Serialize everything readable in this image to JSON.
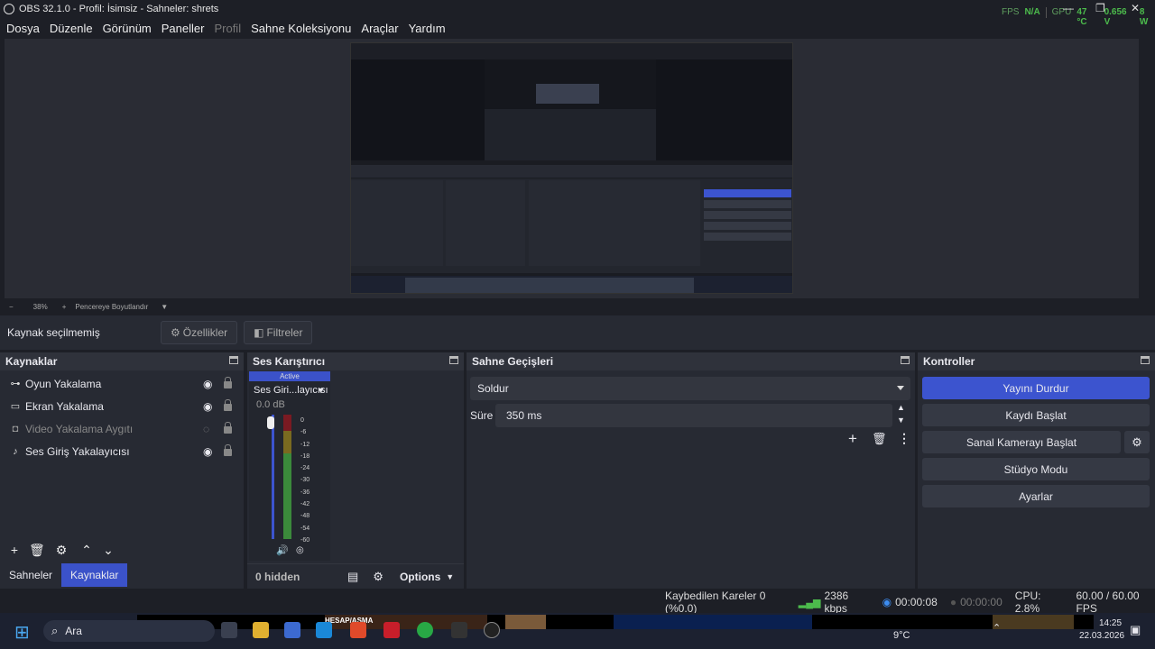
{
  "window": {
    "title": "OBS 32.1.0 - Profil: İsimsiz - Sahneler: shrets",
    "fps_label": "FPS",
    "fps_value": "N/A",
    "gpu_label": "GPU",
    "gpu_temp": "47 °C",
    "gpu_volt": "0.656 V",
    "gpu_watt": "8 W"
  },
  "menu": [
    "Dosya",
    "Düzenle",
    "Görünüm",
    "Paneller",
    "Profil",
    "Sahne Koleksiyonu",
    "Araçlar",
    "Yardım"
  ],
  "zoom": {
    "minus": "−",
    "level": "38%",
    "plus": "+",
    "mode": "Pencereye Boyutlandır"
  },
  "source_bar": {
    "no_selection": "Kaynak seçilmemiş",
    "properties": "Özellikler",
    "filters": "Filtreler"
  },
  "sources": {
    "title": "Kaynaklar",
    "items": [
      {
        "label": "Oyun Yakalama",
        "icon": "gamepad-icon",
        "visible": true
      },
      {
        "label": "Ekran Yakalama",
        "icon": "monitor-icon",
        "visible": true
      },
      {
        "label": "Video Yakalama Aygıtı",
        "icon": "camera-icon",
        "visible": false
      },
      {
        "label": "Ses Giriş Yakalayıcısı",
        "icon": "microphone-icon",
        "visible": true
      }
    ]
  },
  "tabs": {
    "scenes": "Sahneler",
    "sources": "Kaynaklar"
  },
  "mixer": {
    "title": "Ses Karıştırıcı",
    "active": "Active",
    "channel": "Ses Giri...layıcısı",
    "db": "0.0 dB",
    "scale": [
      "0",
      "-6",
      "-12",
      "-18",
      "-24",
      "-30",
      "-36",
      "-42",
      "-48",
      "-54",
      "-60"
    ],
    "hidden": "0 hidden",
    "options": "Options"
  },
  "transitions": {
    "title": "Sahne Geçişleri",
    "type": "Soldur",
    "duration_label": "Süre",
    "duration": "350 ms"
  },
  "controls": {
    "title": "Kontroller",
    "stop_stream": "Yayını Durdur",
    "start_record": "Kaydı Başlat",
    "virtual_cam": "Sanal Kamerayı Başlat",
    "studio_mode": "Stüdyo Modu",
    "settings": "Ayarlar"
  },
  "status": {
    "dropped": "Kaybedilen Kareler 0 (%0.0)",
    "bitrate": "2386 kbps",
    "stream_time": "00:00:08",
    "record_time": "00:00:00",
    "cpu": "CPU: 2.8%",
    "fps": "60.00 / 60.00 FPS"
  },
  "taskbar": {
    "search": "Ara",
    "weather": "9°C",
    "time": "14:25",
    "date": "22.03.2026",
    "banner": "HESAP/ASMA"
  },
  "colors": {
    "accent": "#3c54cf",
    "good": "#4cbb4c",
    "panel": "#272a33"
  }
}
